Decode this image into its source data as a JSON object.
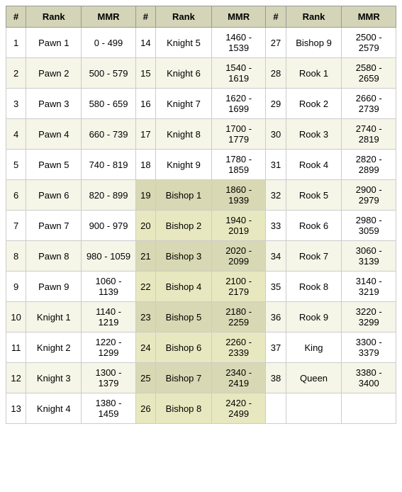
{
  "headers": [
    {
      "label": "#"
    },
    {
      "label": "Rank"
    },
    {
      "label": "MMR"
    },
    {
      "label": "#"
    },
    {
      "label": "Rank"
    },
    {
      "label": "MMR"
    },
    {
      "label": "#"
    },
    {
      "label": "Rank"
    },
    {
      "label": "MMR"
    }
  ],
  "rows": [
    {
      "c1": "1",
      "r1": "Pawn 1",
      "m1": "0 - 499",
      "c2": "14",
      "r2": "Knight 5",
      "m2": "1460 - 1539",
      "c3": "27",
      "r3": "Bishop 9",
      "m3": "2500 - 2579"
    },
    {
      "c1": "2",
      "r1": "Pawn 2",
      "m1": "500 - 579",
      "c2": "15",
      "r2": "Knight 6",
      "m2": "1540 - 1619",
      "c3": "28",
      "r3": "Rook 1",
      "m3": "2580 - 2659"
    },
    {
      "c1": "3",
      "r1": "Pawn 3",
      "m1": "580 - 659",
      "c2": "16",
      "r2": "Knight 7",
      "m2": "1620 - 1699",
      "c3": "29",
      "r3": "Rook 2",
      "m3": "2660 - 2739"
    },
    {
      "c1": "4",
      "r1": "Pawn 4",
      "m1": "660 - 739",
      "c2": "17",
      "r2": "Knight 8",
      "m2": "1700 - 1779",
      "c3": "30",
      "r3": "Rook 3",
      "m3": "2740 - 2819"
    },
    {
      "c1": "5",
      "r1": "Pawn 5",
      "m1": "740 - 819",
      "c2": "18",
      "r2": "Knight 9",
      "m2": "1780 - 1859",
      "c3": "31",
      "r3": "Rook 4",
      "m3": "2820 - 2899"
    },
    {
      "c1": "6",
      "r1": "Pawn 6",
      "m1": "820 - 899",
      "c2": "19",
      "r2": "Bishop 1",
      "m2": "1860 - 1939",
      "c3": "32",
      "r3": "Rook 5",
      "m3": "2900 - 2979"
    },
    {
      "c1": "7",
      "r1": "Pawn 7",
      "m1": "900 - 979",
      "c2": "20",
      "r2": "Bishop 2",
      "m2": "1940 - 2019",
      "c3": "33",
      "r3": "Rook 6",
      "m3": "2980 - 3059"
    },
    {
      "c1": "8",
      "r1": "Pawn 8",
      "m1": "980 - 1059",
      "c2": "21",
      "r2": "Bishop 3",
      "m2": "2020 - 2099",
      "c3": "34",
      "r3": "Rook 7",
      "m3": "3060 - 3139"
    },
    {
      "c1": "9",
      "r1": "Pawn 9",
      "m1": "1060 - 1139",
      "c2": "22",
      "r2": "Bishop 4",
      "m2": "2100 - 2179",
      "c3": "35",
      "r3": "Rook 8",
      "m3": "3140 - 3219"
    },
    {
      "c1": "10",
      "r1": "Knight 1",
      "m1": "1140 - 1219",
      "c2": "23",
      "r2": "Bishop 5",
      "m2": "2180 - 2259",
      "c3": "36",
      "r3": "Rook 9",
      "m3": "3220 - 3299"
    },
    {
      "c1": "11",
      "r1": "Knight 2",
      "m1": "1220 - 1299",
      "c2": "24",
      "r2": "Bishop 6",
      "m2": "2260 - 2339",
      "c3": "37",
      "r3": "King",
      "m3": "3300 - 3379"
    },
    {
      "c1": "12",
      "r1": "Knight 3",
      "m1": "1300 - 1379",
      "c2": "25",
      "r2": "Bishop 7",
      "m2": "2340 - 2419",
      "c3": "38",
      "r3": "Queen",
      "m3": "3380 - 3400"
    },
    {
      "c1": "13",
      "r1": "Knight 4",
      "m1": "1380 - 1459",
      "c2": "26",
      "r2": "Bishop 8",
      "m2": "2420 - 2499",
      "c3": "",
      "r3": "",
      "m3": ""
    }
  ]
}
